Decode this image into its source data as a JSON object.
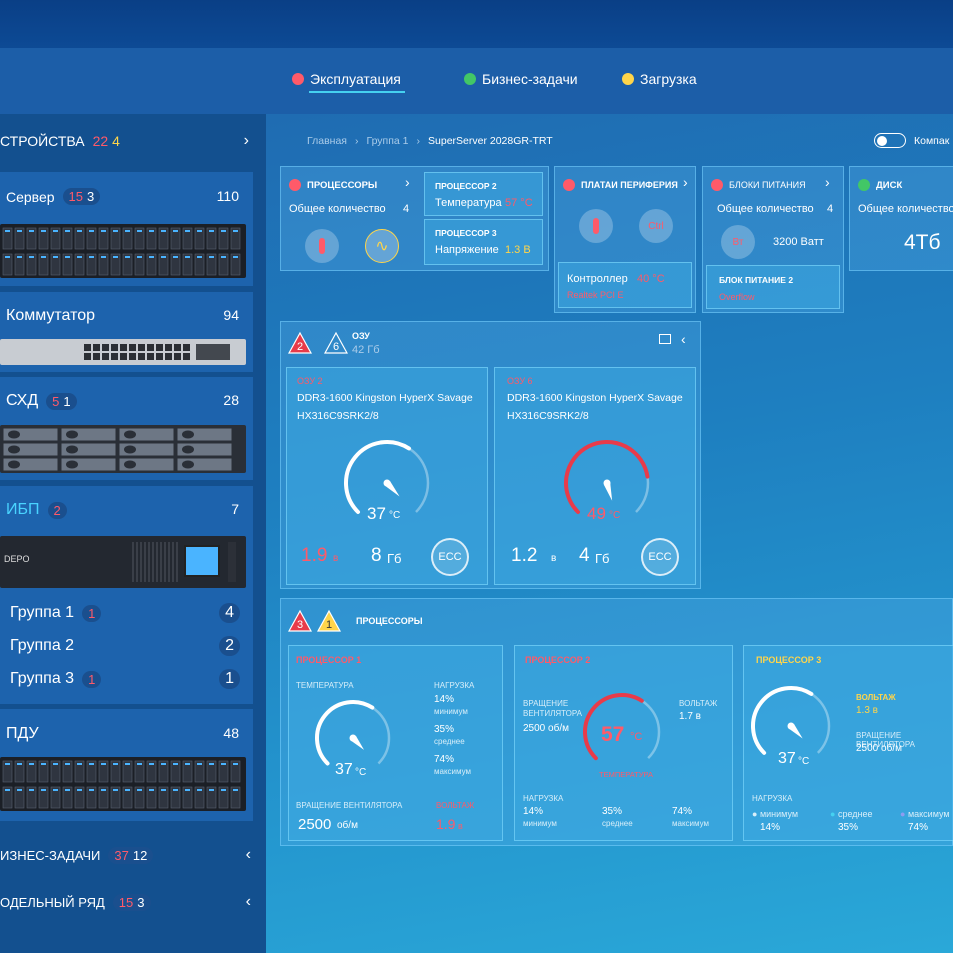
{
  "nav": {
    "exploitation": "Эксплуатация",
    "business": "Бизнес-задачи",
    "load": "Загрузка"
  },
  "sidebar": {
    "devices": {
      "label": "СТРОЙСТВА",
      "red": "22",
      "yellow": "4"
    },
    "server": {
      "label": "Сервер",
      "red": "15",
      "white": "3",
      "count": "110"
    },
    "switch": {
      "label": "Коммутатор",
      "count": "94"
    },
    "storage": {
      "label": "СХД",
      "red": "5",
      "white": "1",
      "count": "28"
    },
    "ups": {
      "label": "ИБП",
      "badge": "2",
      "count": "7",
      "brand": "DEPO"
    },
    "groups": [
      {
        "label": "Группа 1",
        "badge": "1",
        "count": "4"
      },
      {
        "label": "Группа 2",
        "badge": "",
        "count": "2"
      },
      {
        "label": "Группа 3",
        "badge": "1",
        "count": "1"
      }
    ],
    "pdu": {
      "label": "ПДУ",
      "count": "48"
    },
    "business": {
      "label": "ИЗНЕС-ЗАДАЧИ",
      "red": "37",
      "white": "12"
    },
    "models": {
      "label": "ОДЕЛЬНЫЙ РЯД",
      "red": "15",
      "white": "3"
    }
  },
  "breadcrumb": {
    "home": "Главная",
    "group": "Группа 1",
    "current": "SuperServer 2028GR-TRT"
  },
  "compact": "Компак",
  "cpu": {
    "title": "ПРОЦЕССОРЫ",
    "total_label": "Общее количество",
    "total": "4",
    "cpu2_title": "ПРОЦЕССОР 2",
    "cpu2_label": "Температура",
    "cpu2_value": "57 °C",
    "cpu3_title": "ПРОЦЕССОР 3",
    "cpu3_label": "Напряжение",
    "cpu3_value": "1.3 В"
  },
  "periph": {
    "title": "ПЛАТАИ ПЕРИФЕРИЯ",
    "ctrl_label": "Контроллер",
    "ctrl_value": "40 °C",
    "ctrl_sub": "Realtek PCI E",
    "circ2": "Ctrl"
  },
  "psu": {
    "title": "БЛОКИ ПИТАНИЯ",
    "total_label": "Общее количество",
    "total": "4",
    "watts": "3200 Ватт",
    "circ": "Вт",
    "sub_title": "БЛОК ПИТАНИЕ  2",
    "sub_status": "Overflow"
  },
  "disk": {
    "title": "ДИСК",
    "total_label": "Общее количество",
    "size": "4Тб"
  },
  "ram": {
    "badge_red": "2",
    "badge_white": "6",
    "title": "ОЗУ",
    "size": "42 Гб",
    "modules": [
      {
        "slot": "ОЗУ 2",
        "name1": "DDR3-1600 Kingston HyperX Savage",
        "name2": "HX316C9SRK2/8",
        "temp": "37",
        "unit": "°C",
        "volt": "1.9",
        "volt_unit": "в",
        "mem": "8",
        "mem_unit": "Гб",
        "ecc": "ECC",
        "level": 0.62
      },
      {
        "slot": "ОЗУ 6",
        "name1": "DDR3-1600 Kingston HyperX Savage",
        "name2": "HX316C9SRK2/8",
        "temp": "49",
        "unit": "°C",
        "volt": "1.2",
        "volt_unit": "в",
        "mem": "4",
        "mem_unit": "Гб",
        "ecc": "ECC",
        "level": 0.8
      }
    ]
  },
  "procs": {
    "badge_red": "3",
    "badge_yellow": "1",
    "title": "ПРОЦЕССОРЫ",
    "p1": {
      "title": "ПРОЦЕССОР 1",
      "temp_label": "ТЕМПЕРАТУРА",
      "temp": "37",
      "unit": "°C",
      "load_label": "НАГРУЗКА",
      "min": "14%",
      "min_l": "минимум",
      "avg": "35%",
      "avg_l": "среднее",
      "max": "74%",
      "max_l": "максимум",
      "fan_label": "ВРАЩЕНИЕ ВЕНТИЛЯТОРА",
      "fan": "2500",
      "fan_unit": "об/м",
      "volt_label": "ВОЛЬТАЖ",
      "volt": "1.9",
      "volt_unit": "в"
    },
    "p2": {
      "title": "ПРОЦЕССОР 2",
      "fan_label1": "ВРАЩЕНИЕ",
      "fan_label2": "ВЕНТИЛЯТОРА",
      "fan": "2500 об/м",
      "volt_label": "ВОЛЬТАЖ",
      "volt": "1.7 в",
      "temp": "57",
      "unit": "°C",
      "temp_label": "ТЕМПЕРАТУРА",
      "load_label": "НАГРУЗКА",
      "min": "14%",
      "min_l": "минимум",
      "avg": "35%",
      "avg_l": "среднее",
      "max": "74%",
      "max_l": "максимум"
    },
    "p3": {
      "title": "ПРОЦЕССОР 3",
      "volt_label": "ВОЛЬТАЖ",
      "volt": "1.3 в",
      "fan_label": "ВРАЩЕНИЕ ВЕНТИЛЯТОРА",
      "fan": "2500 об/м",
      "temp": "37",
      "unit": "°C",
      "load_label": "НАГРУЗКА",
      "min_l": "минимум",
      "min": "14%",
      "avg_l": "среднее",
      "avg": "35%",
      "max_l": "максимум",
      "max": "74%"
    }
  },
  "colors": {
    "alert": "#ff5a69",
    "warn": "#ffd54a",
    "ok": "#42c766",
    "accent": "#45d1f0"
  }
}
